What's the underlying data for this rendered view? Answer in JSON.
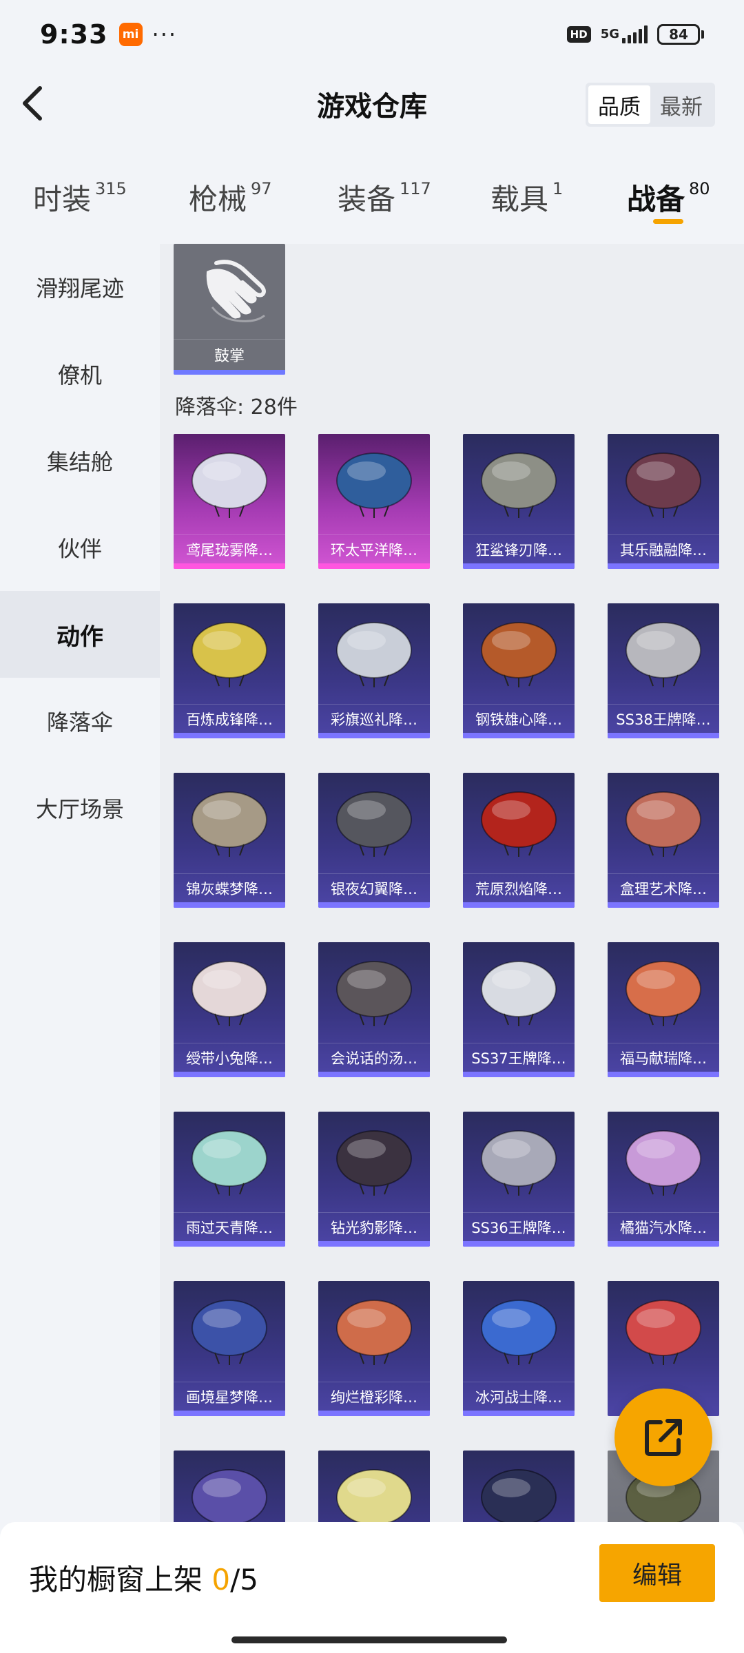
{
  "status_bar": {
    "time": "9:33",
    "mi_badge": "mi",
    "hd": "HD",
    "network": "5G",
    "battery": "84"
  },
  "header": {
    "title": "游戏仓库",
    "sort_options": [
      "品质",
      "最新"
    ],
    "active_sort": "品质"
  },
  "tabs": [
    {
      "label": "时装",
      "count": "315"
    },
    {
      "label": "枪械",
      "count": "97"
    },
    {
      "label": "装备",
      "count": "117"
    },
    {
      "label": "载具",
      "count": "1"
    },
    {
      "label": "战备",
      "count": "80",
      "active": true
    }
  ],
  "sidebar": {
    "items": [
      "滑翔尾迹",
      "僚机",
      "集结舱",
      "伙伴",
      "动作",
      "降落伞",
      "大厅场景"
    ],
    "active": "动作"
  },
  "content": {
    "applause": {
      "label": "鼓掌"
    },
    "section_title": "降落伞: 28件",
    "items": [
      {
        "label": "鸢尾珑雾降…",
        "rarity": "legendary",
        "color": "#d9d9e8"
      },
      {
        "label": "环太平洋降…",
        "rarity": "legendary",
        "color": "#2f5e9c"
      },
      {
        "label": "狂鲨锋刃降…",
        "rarity": "epic",
        "color": "#8d8f86"
      },
      {
        "label": "其乐融融降…",
        "rarity": "epic",
        "color": "#6d3b4c"
      },
      {
        "label": "百炼成锋降…",
        "rarity": "epic",
        "color": "#d8c24a"
      },
      {
        "label": "彩旗巡礼降…",
        "rarity": "epic",
        "color": "#c9ced8"
      },
      {
        "label": "钢铁雄心降…",
        "rarity": "epic",
        "color": "#b55a2a"
      },
      {
        "label": "SS38王牌降…",
        "rarity": "epic",
        "color": "#b7b7bd"
      },
      {
        "label": "锦灰蝶梦降…",
        "rarity": "epic",
        "color": "#a69a86"
      },
      {
        "label": "银夜幻翼降…",
        "rarity": "epic",
        "color": "#55565e"
      },
      {
        "label": "荒原烈焰降…",
        "rarity": "epic",
        "color": "#b3241c"
      },
      {
        "label": "盒理艺术降…",
        "rarity": "epic",
        "color": "#c06b5a"
      },
      {
        "label": "绶带小兔降…",
        "rarity": "epic",
        "color": "#e4d7d8"
      },
      {
        "label": "会说话的汤…",
        "rarity": "epic",
        "color": "#5b555a"
      },
      {
        "label": "SS37王牌降…",
        "rarity": "epic",
        "color": "#d8dbe2"
      },
      {
        "label": "福马献瑞降…",
        "rarity": "epic",
        "color": "#d76e4a"
      },
      {
        "label": "雨过天青降…",
        "rarity": "epic",
        "color": "#9cd4cc"
      },
      {
        "label": "钻光豹影降…",
        "rarity": "epic",
        "color": "#3b3240"
      },
      {
        "label": "SS36王牌降…",
        "rarity": "epic",
        "color": "#a8a9b8"
      },
      {
        "label": "橘猫汽水降…",
        "rarity": "epic",
        "color": "#c89ad8"
      },
      {
        "label": "画境星梦降…",
        "rarity": "epic",
        "color": "#3c52a8"
      },
      {
        "label": "绚烂橙彩降…",
        "rarity": "epic",
        "color": "#cf6c4a"
      },
      {
        "label": "冰河战士降…",
        "rarity": "epic",
        "color": "#3b6ad0"
      },
      {
        "label": "",
        "rarity": "epic",
        "color": "#d24a4a"
      },
      {
        "label": "",
        "rarity": "epic",
        "color": "#5a4fa8"
      },
      {
        "label": "",
        "rarity": "epic",
        "color": "#e0d98c"
      },
      {
        "label": "",
        "rarity": "epic",
        "color": "#2a2f55"
      },
      {
        "label": "",
        "rarity": "gray",
        "color": "#5c6042"
      }
    ]
  },
  "bottom_bar": {
    "showcase_prefix": "我的橱窗上架 ",
    "showcase_count": "0",
    "showcase_total": "/5",
    "edit_label": "编辑"
  },
  "colors": {
    "accent": "#f6a500",
    "epic_bar": "#7b74ff",
    "legendary_bar": "#ff55e0"
  }
}
